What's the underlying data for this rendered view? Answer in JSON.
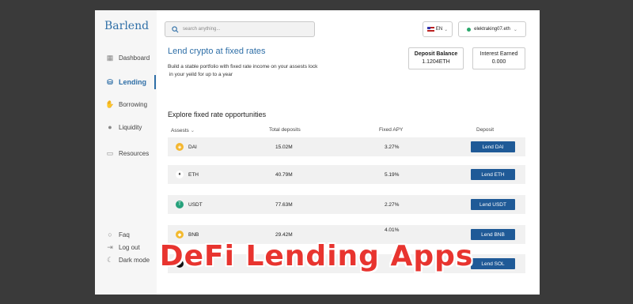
{
  "app": {
    "name": "Barlend"
  },
  "search": {
    "placeholder": "search anything..."
  },
  "header": {
    "language": "EN",
    "wallet": "elektraking07.eth"
  },
  "sidebar": {
    "items": [
      {
        "label": "Dashboard",
        "icon": "grid-icon"
      },
      {
        "label": "Lending",
        "icon": "coins-icon",
        "active": true
      },
      {
        "label": "Borrowing",
        "icon": "hand-icon"
      },
      {
        "label": "Liquidity",
        "icon": "drop-icon"
      },
      {
        "label": "Resources",
        "icon": "folder-icon"
      }
    ],
    "bottom": [
      {
        "label": "Faq",
        "icon": "help-icon"
      },
      {
        "label": "Log out",
        "icon": "logout-icon"
      },
      {
        "label": "Dark mode",
        "icon": "moon-icon"
      }
    ]
  },
  "main": {
    "title": "Lend crypto at fixed rates",
    "description_line1": "Build a stable portfolio with fixed rate income on your assests lock",
    "description_line2": " in your yeild for up to a year",
    "deposit_balance": {
      "label": "Deposit Balance",
      "value": "1.1204ETH"
    },
    "interest_earned": {
      "label": "Interest Earned",
      "value": "0.000"
    },
    "section_title": "Explore fixed rate opportunities",
    "columns": {
      "assets": "Assests",
      "total_deposits": "Total deposits",
      "apy": "Fixed APY",
      "deposit": "Deposit"
    },
    "rows": [
      {
        "asset": "DAI",
        "deposits": "15.02M",
        "apy": "3.27%",
        "button": "Lend DAI",
        "color": "#f4b731",
        "glyph": "◈"
      },
      {
        "asset": "ETH",
        "deposits": "40.79M",
        "apy": "5.19%",
        "button": "Lend ETH",
        "color": "#ffffff",
        "glyph": "♦"
      },
      {
        "asset": "USDT",
        "deposits": "77.63M",
        "apy": "2.27%",
        "button": "Lend USDT",
        "color": "#26a17b",
        "glyph": "T"
      },
      {
        "asset": "BNB",
        "deposits": "29.42M",
        "apy": "4.01%",
        "button": "Lend BNB",
        "color": "#f3ba2f",
        "glyph": "◆"
      },
      {
        "asset": "SO",
        "deposits": "",
        "apy": "",
        "button": "Lend SOL",
        "color": "#111111",
        "glyph": "≡"
      }
    ]
  },
  "overlay": {
    "text": "DeFi Lending Apps"
  }
}
